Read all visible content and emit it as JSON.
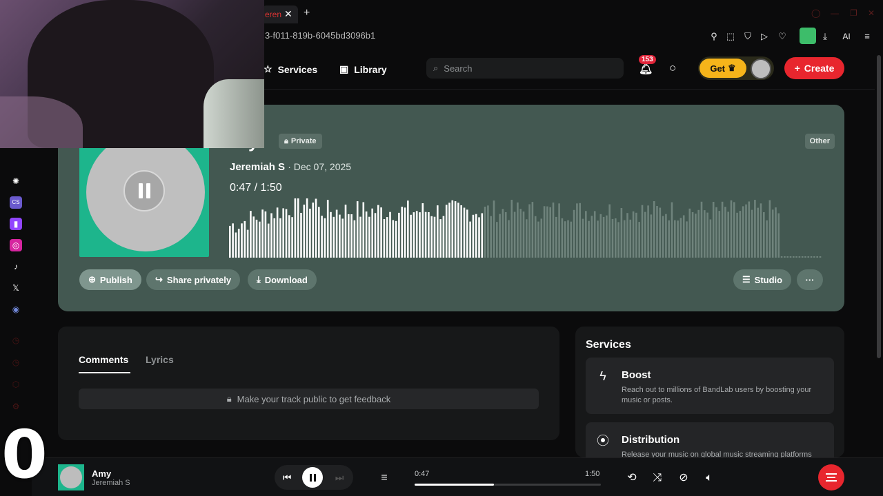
{
  "browser": {
    "tab_fragment": "eren",
    "url_fragment": "3-f011-819b-6045bd3096b1",
    "ai_label": "AI"
  },
  "header": {
    "nav": [
      {
        "label": "Services",
        "icon": "star-icon"
      },
      {
        "label": "Library",
        "icon": "library-icon"
      }
    ],
    "search_placeholder": "Search",
    "notification_count": "153",
    "get_label": "Get",
    "create_label": "Create"
  },
  "track": {
    "title_fragment": "y",
    "privacy": "Private",
    "genre": "Other",
    "artist": "Jeremiah S",
    "date": "· Dec 07, 2025",
    "current_time": "0:47",
    "separator": "/",
    "duration": "1:50",
    "progress_fraction": 0.427,
    "buttons": {
      "publish": "Publish",
      "share": "Share privately",
      "download": "Download",
      "studio": "Studio",
      "more": "···"
    }
  },
  "comments": {
    "tabs": [
      "Comments",
      "Lyrics"
    ],
    "active_tab": "Comments",
    "locked_message": "Make your track public to get feedback"
  },
  "services": {
    "title": "Services",
    "items": [
      {
        "name": "Boost",
        "description": "Reach out to millions of BandLab users by boosting your music or posts.",
        "icon": "bolt-icon"
      },
      {
        "name": "Distribution",
        "description": "Release your music on global music streaming platforms",
        "icon": "distribution-icon"
      }
    ]
  },
  "player": {
    "title": "Amy",
    "artist": "Jeremiah S",
    "current_time": "0:47",
    "duration": "1:50",
    "progress_fraction": 0.427
  },
  "overlay": {
    "counter": "0"
  },
  "colors": {
    "accent_red": "#e8262e",
    "get_yellow": "#f5b41a",
    "card_bg": "#435851",
    "cover_green": "#1db58c"
  }
}
